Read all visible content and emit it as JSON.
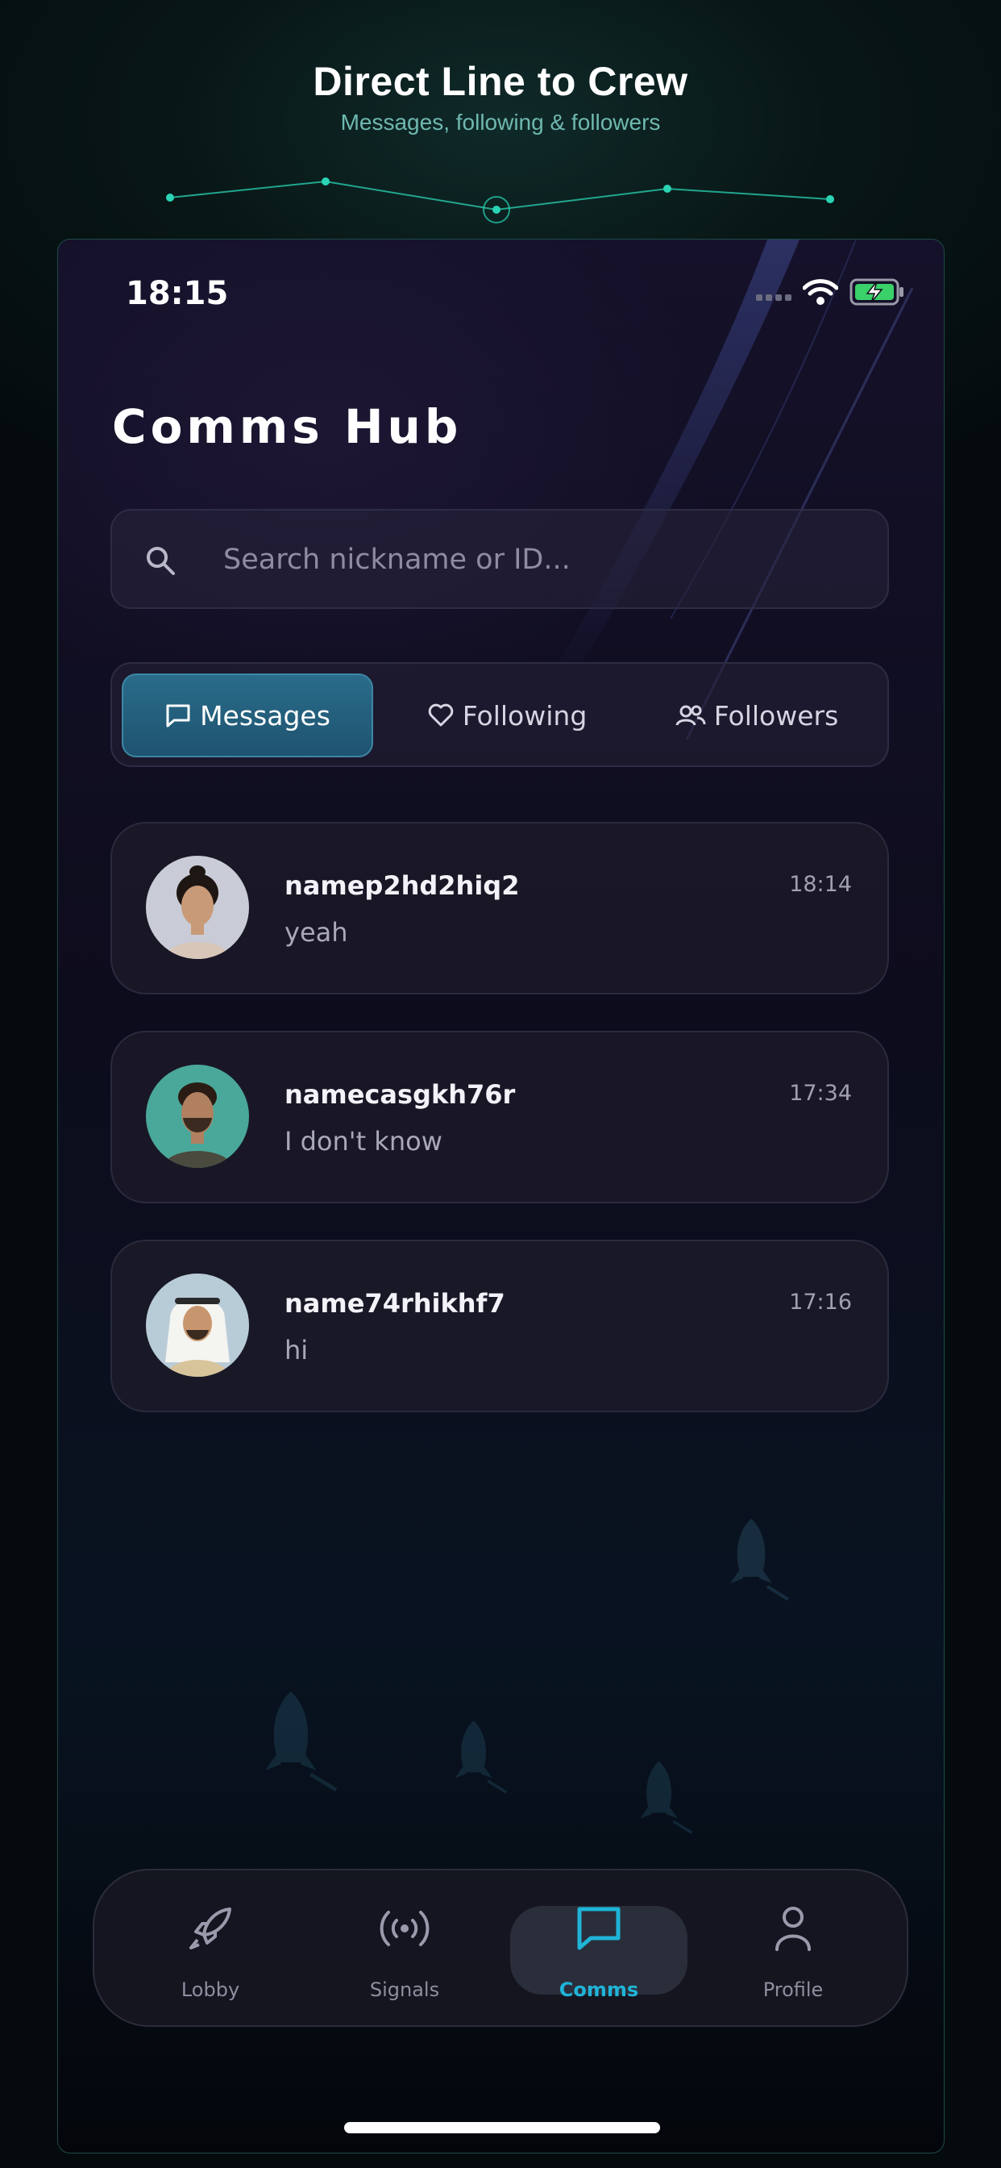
{
  "promo": {
    "title": "Direct Line to Crew",
    "subtitle": "Messages, following & followers"
  },
  "status_bar": {
    "time": "18:15"
  },
  "page_title": "Comms Hub",
  "search": {
    "placeholder": "Search nickname or ID..."
  },
  "tabs": [
    {
      "label": "Messages",
      "active": true
    },
    {
      "label": "Following",
      "active": false
    },
    {
      "label": "Followers",
      "active": false
    }
  ],
  "chats": [
    {
      "name": "namep2hd2hiq2",
      "message": "yeah",
      "time": "18:14"
    },
    {
      "name": "namecasgkh76r",
      "message": "I don't know",
      "time": "17:34"
    },
    {
      "name": "name74rhikhf7",
      "message": "hi",
      "time": "17:16"
    }
  ],
  "bottom_nav": [
    {
      "label": "Lobby",
      "icon": "rocket-icon",
      "active": false
    },
    {
      "label": "Signals",
      "icon": "broadcast-icon",
      "active": false
    },
    {
      "label": "Comms",
      "icon": "chat-bubble-icon",
      "active": true
    },
    {
      "label": "Profile",
      "icon": "person-icon",
      "active": false
    }
  ],
  "colors": {
    "accent": "#1fb4d8",
    "active_tab": "#2a6c8a",
    "teal_line": "#2ad4b4"
  }
}
